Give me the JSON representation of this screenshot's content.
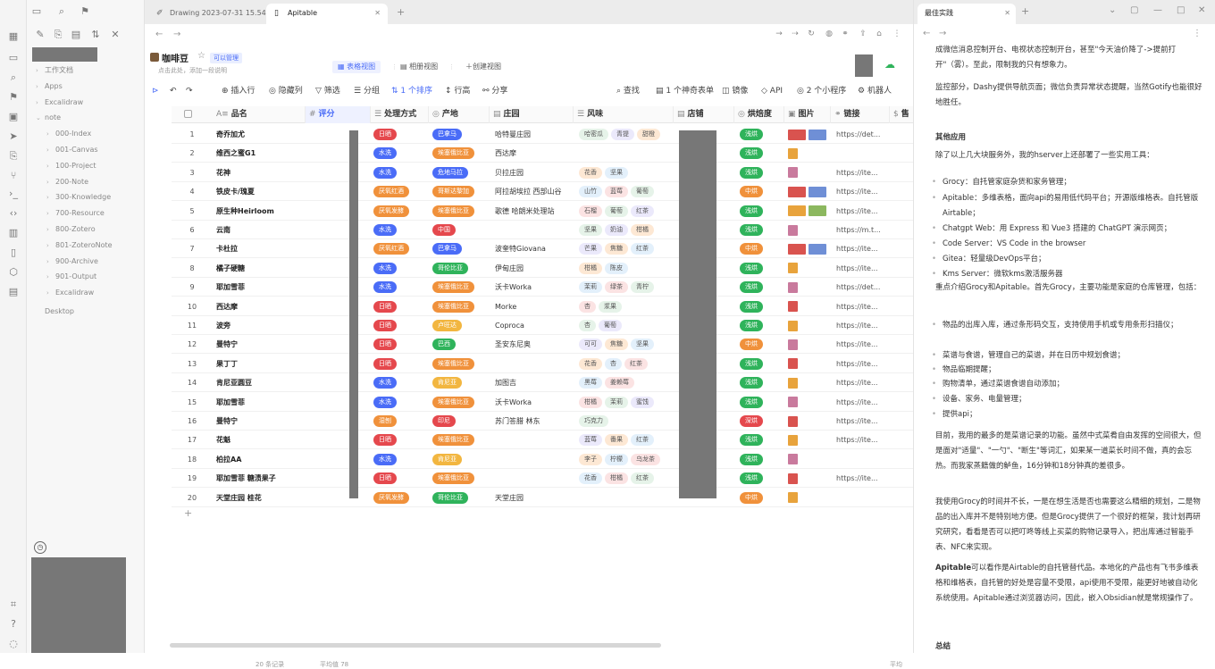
{
  "ribbon": {
    "icons": [
      "grid-icon",
      "files-icon",
      "search-icon",
      "bookmark-icon",
      "calendar-icon",
      "send-icon",
      "copy-icon",
      "branch-icon",
      "terminal-icon",
      "code-icon",
      "book-icon",
      "doc-icon",
      "cube-icon",
      "table-icon",
      "tag-icon",
      "help-icon",
      "question-icon",
      "settings-icon"
    ]
  },
  "sidebar": {
    "tree": [
      {
        "label": "工作文档",
        "depth": 0,
        "caret": "›"
      },
      {
        "label": "Apps",
        "depth": 0,
        "caret": "›"
      },
      {
        "label": "Excalidraw",
        "depth": 0,
        "caret": "›"
      },
      {
        "label": "note",
        "depth": 0,
        "caret": "⌄"
      },
      {
        "label": "000-Index",
        "depth": 1,
        "caret": "›"
      },
      {
        "label": "001-Canvas",
        "depth": 1,
        "caret": "›"
      },
      {
        "label": "100-Project",
        "depth": 1,
        "caret": "›"
      },
      {
        "label": "200-Note",
        "depth": 1,
        "caret": "›"
      },
      {
        "label": "300-Knowledge",
        "depth": 1,
        "caret": "›"
      },
      {
        "label": "700-Resource",
        "depth": 1,
        "caret": "›"
      },
      {
        "label": "800-Zotero",
        "depth": 1,
        "caret": "›"
      },
      {
        "label": "801-ZoteroNote",
        "depth": 1,
        "caret": "›"
      },
      {
        "label": "900-Archive",
        "depth": 1,
        "caret": "›"
      },
      {
        "label": "901-Output",
        "depth": 1,
        "caret": "›"
      },
      {
        "label": "Excalidraw",
        "depth": 1,
        "caret": "›"
      },
      {
        "label": "Desktop",
        "depth": 0,
        "caret": ""
      }
    ]
  },
  "tabs": [
    {
      "label": "Drawing 2023-07-31 15.54...",
      "icon": "draw-icon"
    },
    {
      "label": "Apitable",
      "icon": "doc-icon"
    }
  ],
  "new_tab": "+",
  "right_tab": "最佳实践",
  "table": {
    "title": "咖啡豆",
    "badge": "可以管理",
    "desc": "点击此处，添加一段说明",
    "views": [
      "表格视图",
      "相册视图"
    ],
    "create_view": "创建视图",
    "toolbar": {
      "insert": "插入行",
      "hide": "隐藏列",
      "filter": "筛选",
      "group": "分组",
      "sort": "1 个排序",
      "height": "行高",
      "share": "分享",
      "find": "查找",
      "form": "1 个神奇表单",
      "mirror": "镜像",
      "api": "API",
      "widgets": "2 个小程序",
      "robot": "机器人"
    },
    "columns": [
      "品名",
      "评分",
      "处理方式",
      "产地",
      "庄园",
      "风味",
      "店铺",
      "烘焙度",
      "图片",
      "链接",
      "售"
    ],
    "rows": [
      {
        "n": "1",
        "name": "奇乔加尤",
        "proc": "日晒",
        "origin": "巴拿马",
        "estate": "哈特曼庄园",
        "flavor": [
          "哈密瓜",
          "青提",
          "甜橙"
        ],
        "roast": "浅烘",
        "img": 2,
        "link": "https://det..."
      },
      {
        "n": "2",
        "name": "维西之蜜G1",
        "proc": "水洗",
        "origin": "埃塞俄比亚",
        "estate": "西达摩",
        "flavor": [],
        "roast": "浅烘",
        "img": 1,
        "link": ""
      },
      {
        "n": "3",
        "name": "花神",
        "proc": "水洗",
        "origin": "危地马拉",
        "estate": "贝拉庄园",
        "flavor": [
          "花香",
          "坚果"
        ],
        "roast": "浅烘",
        "img": 1,
        "link": "https://ite..."
      },
      {
        "n": "4",
        "name": "铁皮卡/瑰夏",
        "proc": "厌氧红酒",
        "origin": "哥斯达黎加",
        "estate": "阿拉胡埃拉 西部山谷",
        "flavor": [
          "山竹",
          "蓝莓",
          "葡萄"
        ],
        "roast": "中烘",
        "img": 2,
        "link": "https://ite..."
      },
      {
        "n": "5",
        "name": "原生种Heirloom",
        "proc": "厌氧发酵",
        "origin": "埃塞俄比亚",
        "estate": "歌德 哈朗米处理站",
        "flavor": [
          "石榴",
          "葡萄",
          "红茶"
        ],
        "roast": "浅烘",
        "img": 2,
        "link": "https://ite..."
      },
      {
        "n": "6",
        "name": "云南",
        "proc": "水洗",
        "origin": "中国",
        "estate": "",
        "flavor": [
          "坚果",
          "奶油",
          "柑橘"
        ],
        "roast": "浅烘",
        "img": 1,
        "link": "https://m.t..."
      },
      {
        "n": "7",
        "name": "卡杜拉",
        "proc": "厌氧红酒",
        "origin": "巴拿马",
        "estate": "波奎特Giovana",
        "flavor": [
          "芒果",
          "焦糖",
          "红茶"
        ],
        "roast": "中烘",
        "img": 2,
        "link": "https://ite..."
      },
      {
        "n": "8",
        "name": "橘子硬糖",
        "proc": "水洗",
        "origin": "哥伦比亚",
        "estate": "伊甸庄园",
        "flavor": [
          "柑橘",
          "陈皮"
        ],
        "roast": "浅烘",
        "img": 1,
        "link": "https://ite..."
      },
      {
        "n": "9",
        "name": "耶加雪菲",
        "proc": "水洗",
        "origin": "埃塞俄比亚",
        "estate": "沃卡Worka",
        "flavor": [
          "茉莉",
          "绿茶",
          "青柠"
        ],
        "roast": "浅烘",
        "img": 1,
        "link": "https://det..."
      },
      {
        "n": "10",
        "name": "西达摩",
        "proc": "日晒",
        "origin": "埃塞俄比亚",
        "estate": "Morke",
        "flavor": [
          "杏",
          "浆果"
        ],
        "roast": "浅烘",
        "img": 1,
        "link": "https://ite..."
      },
      {
        "n": "11",
        "name": "波旁",
        "proc": "日晒",
        "origin": "卢旺达",
        "estate": "Coproca",
        "flavor": [
          "杏",
          "葡萄"
        ],
        "roast": "浅烘",
        "img": 1,
        "link": "https://ite..."
      },
      {
        "n": "12",
        "name": "曼特宁",
        "proc": "日晒",
        "origin": "巴西",
        "estate": "圣安东尼奥",
        "flavor": [
          "可可",
          "焦糖",
          "坚果"
        ],
        "roast": "中烘",
        "img": 1,
        "link": "https://ite..."
      },
      {
        "n": "13",
        "name": "果丁丁",
        "proc": "日晒",
        "origin": "埃塞俄比亚",
        "estate": "",
        "flavor": [
          "花香",
          "杏",
          "红茶"
        ],
        "roast": "浅烘",
        "img": 1,
        "link": "https://ite..."
      },
      {
        "n": "14",
        "name": "肯尼亚圆豆",
        "proc": "水洗",
        "origin": "肯尼亚",
        "estate": "加图吉",
        "flavor": [
          "黑莓",
          "姜赖莓"
        ],
        "roast": "浅烘",
        "img": 1,
        "link": "https://ite..."
      },
      {
        "n": "15",
        "name": "耶加雪菲",
        "proc": "水洗",
        "origin": "埃塞俄比亚",
        "estate": "沃卡Worka",
        "flavor": [
          "柑橘",
          "茉莉",
          "蜜饯"
        ],
        "roast": "浅烘",
        "img": 1,
        "link": "https://ite..."
      },
      {
        "n": "16",
        "name": "曼特宁",
        "proc": "湿刨",
        "origin": "印尼",
        "estate": "苏门答腊 林东",
        "flavor": [
          "巧克力"
        ],
        "roast": "深烘",
        "img": 1,
        "link": "https://ite..."
      },
      {
        "n": "17",
        "name": "花魁",
        "proc": "日晒",
        "origin": "埃塞俄比亚",
        "estate": "",
        "flavor": [
          "蓝莓",
          "番果",
          "红茶"
        ],
        "roast": "浅烘",
        "img": 1,
        "link": "https://ite..."
      },
      {
        "n": "18",
        "name": "柏拉AA",
        "proc": "水洗",
        "origin": "肯尼亚",
        "estate": "",
        "flavor": [
          "李子",
          "柠檬",
          "乌龙茶"
        ],
        "roast": "浅烘",
        "img": 1,
        "link": ""
      },
      {
        "n": "19",
        "name": "耶加雪菲 糖渍果子",
        "proc": "日晒",
        "origin": "埃塞俄比亚",
        "estate": "",
        "flavor": [
          "花香",
          "柑橘",
          "红茶"
        ],
        "roast": "浅烘",
        "img": 1,
        "link": "https://ite..."
      },
      {
        "n": "20",
        "name": "天堂庄园 桂花",
        "proc": "厌氧发酵",
        "origin": "哥伦比亚",
        "estate": "天堂庄园",
        "flavor": [],
        "roast": "中烘",
        "img": 1,
        "link": ""
      }
    ],
    "add_row": "+",
    "records": "20 条记录",
    "avg": "平均值 78",
    "avg_label": "平均"
  },
  "colors": {
    "red": "#e5484d",
    "blue": "#4a6cf7",
    "orange": "#f0913b",
    "purple": "#7b6ddc",
    "green": "#2fb35b",
    "accent": "#4a6cf7"
  },
  "article": {
    "p1": "成微信消息控制开台、电视状态控制开台，甚至\"今天油价降了->提前打开\"（雾）。至此，限制我的只有想象力。",
    "p2": "监控部分，Dashy提供导航页面；微信负责异常状态提醒，当然Gotify也能很好地胜任。",
    "h_other": "其他应用",
    "p3": "除了以上几大块服务外，我的hserver上还部署了一些实用工具：",
    "tools": [
      {
        "name": "Grocy",
        "desc": "：自托管家庭杂货和家务管理；"
      },
      {
        "name": "Apitable",
        "desc": "：多维表格，面向api的易用低代码平台；开源版维格表。自托管版Airtable；"
      },
      {
        "name": "Chatgpt Web",
        "desc": "：用 Express 和 Vue3 搭建的 ChatGPT 演示网页；"
      },
      {
        "name": "Code Server",
        "desc": "：VS Code in the browser"
      },
      {
        "name": "Gitea",
        "desc": "：轻量级DevOps平台；"
      },
      {
        "name": "Kms Server",
        "desc": "：微软kms激活服务器"
      }
    ],
    "p4": "重点介绍Grocy和Apitable。首先Grocy，主要功能是家庭的仓库管理，包括：",
    "features": [
      "物品的出库入库，通过条形码交互，支持使用手机或专用条形扫描仪；",
      "菜谱与食谱，管理自己的菜谱，并在日历中规划食谱；",
      "物品临期提醒；",
      "购物清单，通过菜谱食谱自动添加；",
      "设备、家务、电量管理；",
      "提供api；"
    ],
    "p5": "目前，我用的最多的是菜谱记录的功能。虽然中式菜肴自由发挥的空间很大，但是面对\"适量\"、\"一勺\"、\"断生\"等词汇，如果某一道菜长时间不做，真的会忘热。而我家蒸籍做的鲈鱼，16分钟和18分钟真的差很多。",
    "p6": "我使用Grocy的时间并不长，一是在想生活是否也需要这么精细的规划，二是物品的出入库并不是特别地方便。但是Grocy提供了一个很好的框架，我计划再研究研究，看看是否可以把叮咚等线上买菜的购物记录导入，把出库通过智能手表、NFC来实现。",
    "p7_bold": "Apitable",
    "p7": "可以看作是Airtable的自托管替代品。本地化的产品也有飞书多维表格和维格表，自托管的好处是容量不受限，api使用不受限，能更好地被自动化系统使用。Apitable通过浏览器访问，因此，嵌入Obsidian就是常规操作了。",
    "h_sum": "总结"
  }
}
